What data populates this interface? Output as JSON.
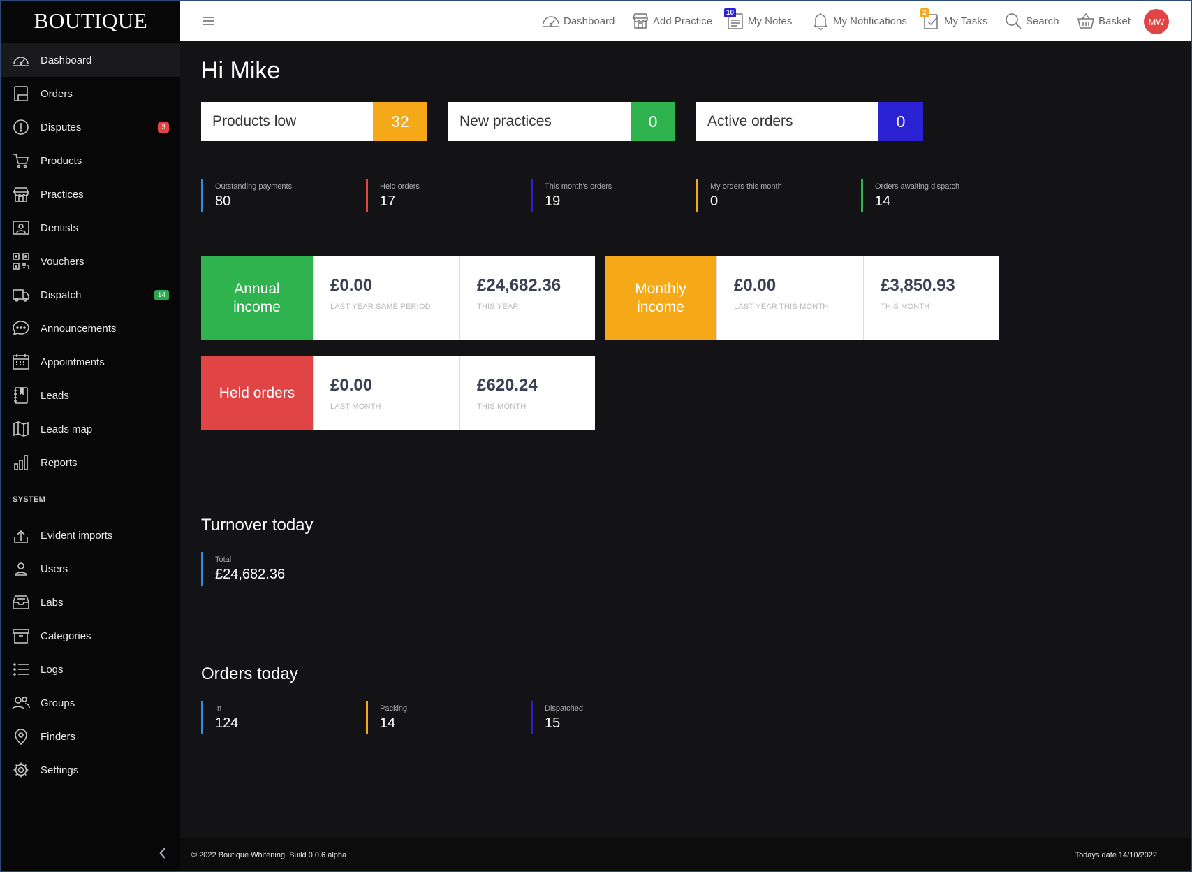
{
  "brand": "BOUTIQUE",
  "sidebar": {
    "items": [
      {
        "label": "Dashboard",
        "icon": "dashboard-icon",
        "active": true
      },
      {
        "label": "Orders",
        "icon": "orders-icon"
      },
      {
        "label": "Disputes",
        "icon": "alert-circle-icon",
        "badge": "3",
        "badge_color": "#e04444"
      },
      {
        "label": "Products",
        "icon": "cart-icon"
      },
      {
        "label": "Practices",
        "icon": "store-icon"
      },
      {
        "label": "Dentists",
        "icon": "id-card-icon"
      },
      {
        "label": "Vouchers",
        "icon": "qr-code-icon"
      },
      {
        "label": "Dispatch",
        "icon": "truck-icon",
        "badge": "14",
        "badge_color": "#2aa84a"
      },
      {
        "label": "Announcements",
        "icon": "chat-bubble-icon"
      },
      {
        "label": "Appointments",
        "icon": "calendar-icon"
      },
      {
        "label": "Leads",
        "icon": "notebook-icon"
      },
      {
        "label": "Leads map",
        "icon": "map-icon"
      },
      {
        "label": "Reports",
        "icon": "bar-chart-icon"
      }
    ],
    "system_title": "SYSTEM",
    "system_items": [
      {
        "label": "Evident imports",
        "icon": "upload-icon"
      },
      {
        "label": "Users",
        "icon": "user-icon"
      },
      {
        "label": "Labs",
        "icon": "inbox-icon"
      },
      {
        "label": "Categories",
        "icon": "archive-icon"
      },
      {
        "label": "Logs",
        "icon": "list-icon"
      },
      {
        "label": "Groups",
        "icon": "users-icon"
      },
      {
        "label": "Finders",
        "icon": "map-pin-icon"
      },
      {
        "label": "Settings",
        "icon": "gear-icon"
      }
    ]
  },
  "topbar": {
    "dashboard": "Dashboard",
    "add_practice": "Add Practice",
    "my_notes": "My Notes",
    "my_notes_badge": "10",
    "my_notifications": "My Notifications",
    "my_tasks": "My Tasks",
    "my_tasks_badge": "2",
    "search": "Search",
    "basket": "Basket",
    "avatar": "MW"
  },
  "main": {
    "greeting": "Hi Mike",
    "stat_boxes": [
      {
        "label": "Products low",
        "value": "32",
        "color": "#f5a918"
      },
      {
        "label": "New practices",
        "value": "0",
        "color": "#2fb34f"
      },
      {
        "label": "Active orders",
        "value": "0",
        "color": "#2b22d4"
      }
    ],
    "metrics": [
      {
        "label": "Outstanding payments",
        "value": "80",
        "color": "#2f8de8"
      },
      {
        "label": "Held orders",
        "value": "17",
        "color": "#e04444"
      },
      {
        "label": "This month's orders",
        "value": "19",
        "color": "#2b22d4"
      },
      {
        "label": "My orders this month",
        "value": "0",
        "color": "#f5a918"
      },
      {
        "label": "Orders awaiting dispatch",
        "value": "14",
        "color": "#2fb34f"
      }
    ],
    "income_boxes": [
      {
        "title": "Annual income",
        "color": "#2fb34f",
        "cells": [
          {
            "value": "£0.00",
            "sub": "Last year same period"
          },
          {
            "value": "£24,682.36",
            "sub": "This year"
          }
        ]
      },
      {
        "title": "Monthly income",
        "color": "#f5a918",
        "cells": [
          {
            "value": "£0.00",
            "sub": "Last year this month"
          },
          {
            "value": "£3,850.93",
            "sub": "This month"
          }
        ]
      },
      {
        "title": "Held orders",
        "color": "#e04444",
        "cells": [
          {
            "value": "£0.00",
            "sub": "Last month"
          },
          {
            "value": "£620.24",
            "sub": "This month"
          }
        ]
      }
    ],
    "turnover": {
      "title": "Turnover today",
      "metrics": [
        {
          "label": "Total",
          "value": "£24,682.36",
          "color": "#2f8de8"
        }
      ]
    },
    "orders_today": {
      "title": "Orders today",
      "metrics": [
        {
          "label": "In",
          "value": "124",
          "color": "#2f8de8"
        },
        {
          "label": "Packing",
          "value": "14",
          "color": "#f5a918"
        },
        {
          "label": "Dispatched",
          "value": "15",
          "color": "#2b22d4"
        }
      ]
    }
  },
  "footer": {
    "left": "© 2022 Boutique Whitening. Build 0.0.6 alpha",
    "right": "Todays date 14/10/2022"
  }
}
